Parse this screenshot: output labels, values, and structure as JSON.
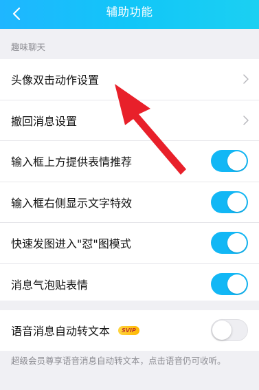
{
  "header": {
    "title": "辅助功能",
    "back_icon": "chevron-left-icon"
  },
  "section": {
    "label": "趣味聊天"
  },
  "items": [
    {
      "label": "头像双击动作设置",
      "control": "chevron"
    },
    {
      "label": "撤回消息设置",
      "control": "chevron"
    },
    {
      "label": "输入框上方提供表情推荐",
      "control": "toggle",
      "state": "on"
    },
    {
      "label": "输入框右侧显示文字特效",
      "control": "toggle",
      "state": "on"
    },
    {
      "label": "快速发图进入\"怼\"图模式",
      "control": "toggle",
      "state": "on"
    },
    {
      "label": "消息气泡贴表情",
      "control": "toggle",
      "state": "on"
    }
  ],
  "voice_item": {
    "label": "语音消息自动转文本",
    "badge": "SVIP",
    "state": "off"
  },
  "footnote": "超级会员尊享语音消息自动转文本，点击语音仍可收听。",
  "colors": {
    "accent": "#12b7f5",
    "arrow": "#e8202a",
    "svip_badge": "#ffc400"
  }
}
